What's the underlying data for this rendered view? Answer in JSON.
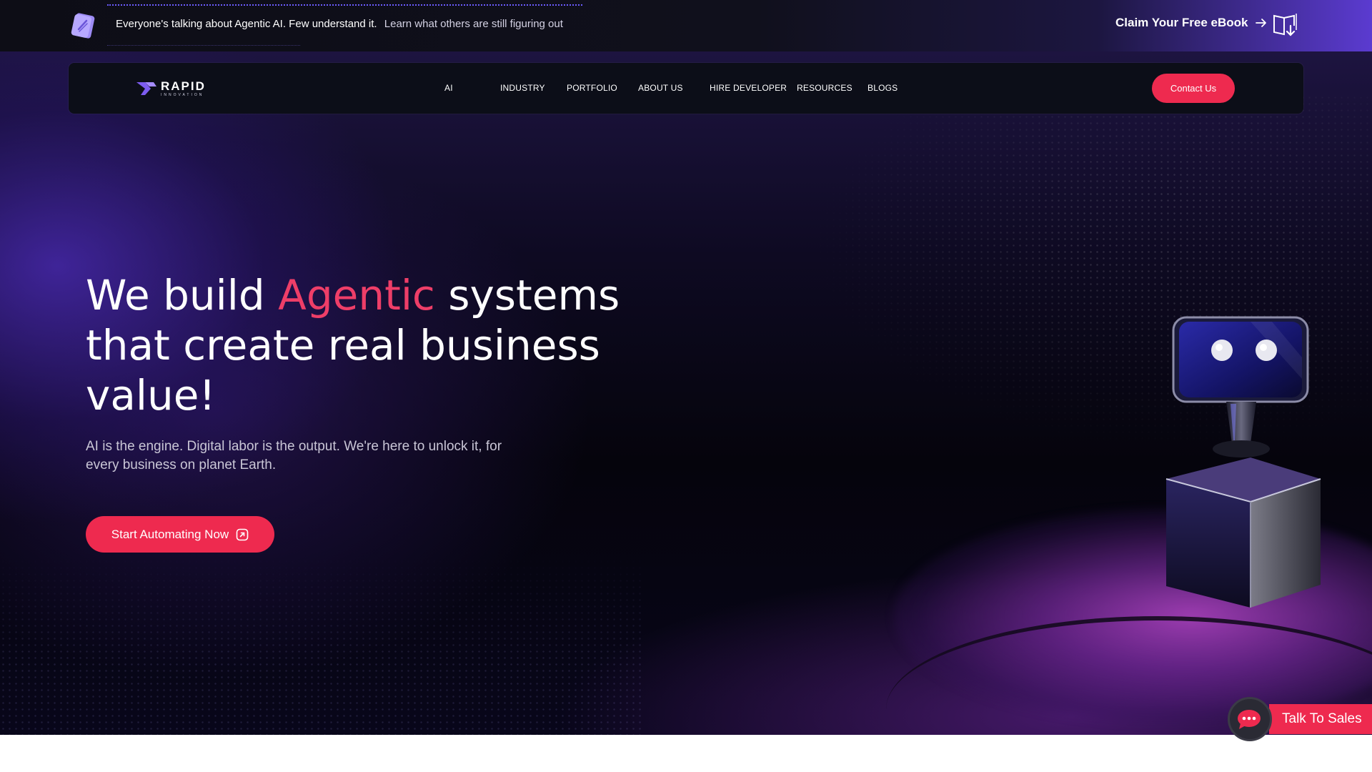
{
  "banner": {
    "lead_text": "Everyone's talking about Agentic AI. Few understand it.",
    "sub_text": "Learn what others are still figuring out",
    "cta_label": "Claim Your Free eBook",
    "book_icon": "book-icon",
    "ebook_icon": "ebook-download-icon"
  },
  "nav": {
    "logo_text": "RAPID",
    "logo_subtext": "INNOVATION",
    "items": [
      "AI",
      "INDUSTRY",
      "PORTFOLIO",
      "ABOUT US",
      "HIRE DEVELOPER",
      "RESOURCES",
      "BLOGS"
    ],
    "contact_label": "Contact Us"
  },
  "hero": {
    "headline_part1": "We build ",
    "headline_accent": "Agentic",
    "headline_part2": " systems that create real business value!",
    "subline": "AI is the engine. Digital labor is the output. We're here to unlock it, for every business on planet Earth.",
    "cta_label": "Start Automating Now"
  },
  "sales_widget": {
    "label": "Talk To Sales",
    "icon": "chat-bubble-icon"
  },
  "colors": {
    "accent": "#ee2a4f",
    "headline_accent": "#ee3e68",
    "background": "#05040c",
    "purple": "#5b3bd0"
  }
}
